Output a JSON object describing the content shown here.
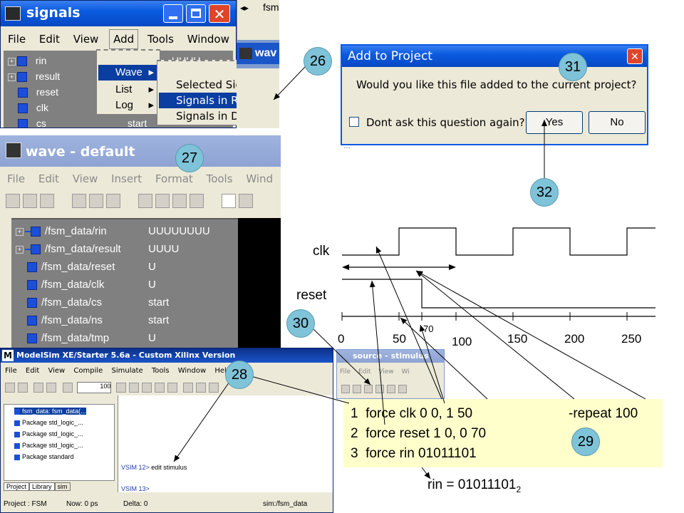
{
  "signals_window": {
    "title": "signals",
    "menu": [
      "File",
      "Edit",
      "View",
      "Add",
      "Tools",
      "Window"
    ],
    "items": [
      {
        "label": "rin",
        "value": "UUUU",
        "expandable": true
      },
      {
        "label": "result",
        "value": "",
        "expandable": true
      },
      {
        "label": "reset",
        "value": "",
        "expandable": false
      },
      {
        "label": "clk",
        "value": "",
        "expandable": false
      },
      {
        "label": "cs",
        "value": "start",
        "expandable": false
      }
    ],
    "add_menu": [
      "Wave",
      "List",
      "Log"
    ],
    "wave_submenu": [
      "Selected Signals",
      "Signals in Region",
      "Signals in Design"
    ]
  },
  "fsm_tab": "fsm",
  "wave_tab": "wav",
  "add_to_project": {
    "title": "Add to Project",
    "question": "Would you like this file added to the current project?",
    "checkbox": "Dont ask this question again?",
    "yes": "Yes",
    "no": "No",
    "close": "✕",
    "partial": "…"
  },
  "wave_window": {
    "title": "wave - default",
    "menu": [
      "File",
      "Edit",
      "View",
      "Insert",
      "Format",
      "Tools",
      "Wind"
    ],
    "signals": [
      {
        "name": "/fsm_data/rin",
        "value": "UUUUUUUU",
        "expandable": true
      },
      {
        "name": "/fsm_data/result",
        "value": "UUUU",
        "expandable": true
      },
      {
        "name": "/fsm_data/reset",
        "value": "U",
        "expandable": false
      },
      {
        "name": "/fsm_data/clk",
        "value": "U",
        "expandable": false
      },
      {
        "name": "/fsm_data/cs",
        "value": "start",
        "expandable": false
      },
      {
        "name": "/fsm_data/ns",
        "value": "start",
        "expandable": false
      },
      {
        "name": "/fsm_data/tmp",
        "value": "U",
        "expandable": false
      }
    ]
  },
  "timing": {
    "clk_label": "clk",
    "reset_label": "reset",
    "ticks": [
      0,
      50,
      100,
      150,
      200,
      250
    ],
    "tick_70": "70"
  },
  "modelsim": {
    "title": "ModelSim XE/Starter 5.6a - Custom Xilinx Version",
    "menu": [
      "File",
      "Edit",
      "View",
      "Compile",
      "Simulate",
      "Tools",
      "Window",
      "Help"
    ],
    "zoom": "100",
    "tree": [
      "fsm_data: fsm_data(...",
      "Package std_logic_...",
      "Package std_logic_...",
      "Package std_logic_...",
      "Package standard"
    ],
    "tabs": [
      "Project",
      "Library",
      "sim"
    ],
    "console": [
      {
        "prompt": "VSIM 12>",
        "cmd": "edit stimulus"
      },
      {
        "prompt": "VSIM 13>",
        "cmd": ""
      }
    ],
    "status": {
      "project": "Project : FSM",
      "now": "Now: 0 ps",
      "delta": "Delta: 0",
      "sim": "sim:/fsm_data"
    }
  },
  "source_window": {
    "title": "source - stimulus",
    "menu": [
      "File",
      "Edit",
      "View",
      "Wi"
    ]
  },
  "stimulus_code": {
    "lines": [
      "1  force clk 0 0, 1 50",
      "2  force reset 1 0, 0 70",
      "3  force rin 01011101"
    ],
    "repeat": "-repeat 100"
  },
  "rin_equation": {
    "text": "rin = 01011101",
    "subscript": "2"
  },
  "callouts": [
    "26",
    "27",
    "28",
    "29",
    "30",
    "31",
    "32"
  ]
}
